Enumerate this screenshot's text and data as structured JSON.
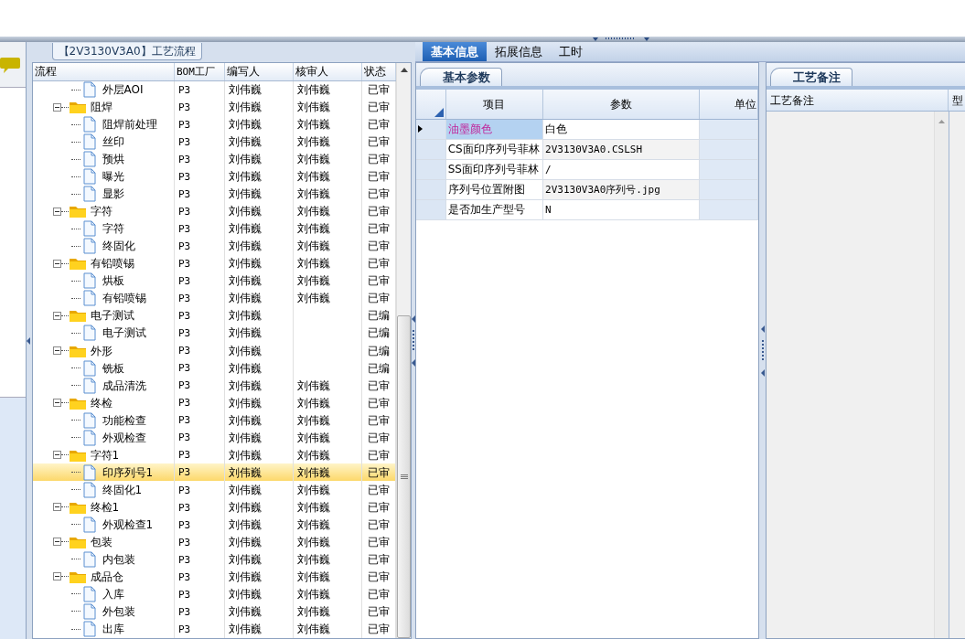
{
  "left_panel": {
    "title": "【2V3130V3A0】工艺流程",
    "columns": [
      "流程",
      "BOM工厂",
      "编写人",
      "核审人",
      "状态"
    ],
    "tree": [
      {
        "label": "外层AOI",
        "kind": "step",
        "selected": false,
        "bom": "P3",
        "author": "刘伟巍",
        "reviewer": "刘伟巍",
        "status": "已审"
      },
      {
        "label": "阻焊",
        "kind": "group",
        "expanded": true,
        "selected": false,
        "bom": "P3",
        "author": "刘伟巍",
        "reviewer": "刘伟巍",
        "status": "已审",
        "children": [
          {
            "label": "阻焊前处理",
            "kind": "step",
            "selected": false,
            "bom": "P3",
            "author": "刘伟巍",
            "reviewer": "刘伟巍",
            "status": "已审"
          },
          {
            "label": "丝印",
            "kind": "step",
            "selected": false,
            "bom": "P3",
            "author": "刘伟巍",
            "reviewer": "刘伟巍",
            "status": "已审"
          },
          {
            "label": "预烘",
            "kind": "step",
            "selected": false,
            "bom": "P3",
            "author": "刘伟巍",
            "reviewer": "刘伟巍",
            "status": "已审"
          },
          {
            "label": "曝光",
            "kind": "step",
            "selected": false,
            "bom": "P3",
            "author": "刘伟巍",
            "reviewer": "刘伟巍",
            "status": "已审"
          },
          {
            "label": "显影",
            "kind": "step",
            "selected": false,
            "bom": "P3",
            "author": "刘伟巍",
            "reviewer": "刘伟巍",
            "status": "已审"
          }
        ]
      },
      {
        "label": "字符",
        "kind": "group",
        "expanded": true,
        "selected": false,
        "bom": "P3",
        "author": "刘伟巍",
        "reviewer": "刘伟巍",
        "status": "已审",
        "children": [
          {
            "label": "字符",
            "kind": "step",
            "selected": false,
            "bom": "P3",
            "author": "刘伟巍",
            "reviewer": "刘伟巍",
            "status": "已审"
          },
          {
            "label": "终固化",
            "kind": "step",
            "selected": false,
            "bom": "P3",
            "author": "刘伟巍",
            "reviewer": "刘伟巍",
            "status": "已审"
          }
        ]
      },
      {
        "label": "有铅喷锡",
        "kind": "group",
        "expanded": true,
        "selected": false,
        "bom": "P3",
        "author": "刘伟巍",
        "reviewer": "刘伟巍",
        "status": "已审",
        "children": [
          {
            "label": "烘板",
            "kind": "step",
            "selected": false,
            "bom": "P3",
            "author": "刘伟巍",
            "reviewer": "刘伟巍",
            "status": "已审"
          },
          {
            "label": "有铅喷锡",
            "kind": "step",
            "selected": false,
            "bom": "P3",
            "author": "刘伟巍",
            "reviewer": "刘伟巍",
            "status": "已审"
          }
        ]
      },
      {
        "label": "电子测试",
        "kind": "group",
        "expanded": true,
        "selected": false,
        "bom": "P3",
        "author": "刘伟巍",
        "status": "已编",
        "children": [
          {
            "label": "电子测试",
            "kind": "step",
            "selected": false,
            "bom": "P3",
            "author": "刘伟巍",
            "status": "已编"
          }
        ]
      },
      {
        "label": "外形",
        "kind": "group",
        "expanded": true,
        "selected": false,
        "bom": "P3",
        "author": "刘伟巍",
        "status": "已编",
        "children": [
          {
            "label": "铣板",
            "kind": "step",
            "selected": false,
            "bom": "P3",
            "author": "刘伟巍",
            "status": "已编"
          },
          {
            "label": "成品清洗",
            "kind": "step",
            "selected": false,
            "bom": "P3",
            "author": "刘伟巍",
            "reviewer": "刘伟巍",
            "status": "已审"
          }
        ]
      },
      {
        "label": "终检",
        "kind": "group",
        "expanded": true,
        "selected": false,
        "bom": "P3",
        "author": "刘伟巍",
        "reviewer": "刘伟巍",
        "status": "已审",
        "children": [
          {
            "label": "功能检查",
            "kind": "step",
            "selected": false,
            "bom": "P3",
            "author": "刘伟巍",
            "reviewer": "刘伟巍",
            "status": "已审"
          },
          {
            "label": "外观检查",
            "kind": "step",
            "selected": false,
            "bom": "P3",
            "author": "刘伟巍",
            "reviewer": "刘伟巍",
            "status": "已审"
          }
        ]
      },
      {
        "label": "字符1",
        "kind": "group",
        "expanded": true,
        "selected": false,
        "bom": "P3",
        "author": "刘伟巍",
        "reviewer": "刘伟巍",
        "status": "已审",
        "children": [
          {
            "label": "印序列号1",
            "kind": "step",
            "selected": true,
            "bom": "P3",
            "author": "刘伟巍",
            "reviewer": "刘伟巍",
            "status": "已审"
          },
          {
            "label": "终固化1",
            "kind": "step",
            "selected": false,
            "bom": "P3",
            "author": "刘伟巍",
            "reviewer": "刘伟巍",
            "status": "已审"
          }
        ]
      },
      {
        "label": "终检1",
        "kind": "group",
        "expanded": true,
        "selected": false,
        "bom": "P3",
        "author": "刘伟巍",
        "reviewer": "刘伟巍",
        "status": "已审",
        "children": [
          {
            "label": "外观检查1",
            "kind": "step",
            "selected": false,
            "bom": "P3",
            "author": "刘伟巍",
            "reviewer": "刘伟巍",
            "status": "已审"
          }
        ]
      },
      {
        "label": "包装",
        "kind": "group",
        "expanded": true,
        "selected": false,
        "bom": "P3",
        "author": "刘伟巍",
        "reviewer": "刘伟巍",
        "status": "已审",
        "children": [
          {
            "label": "内包装",
            "kind": "step",
            "selected": false,
            "bom": "P3",
            "author": "刘伟巍",
            "reviewer": "刘伟巍",
            "status": "已审"
          }
        ]
      },
      {
        "label": "成品仓",
        "kind": "group",
        "expanded": true,
        "selected": false,
        "bom": "P3",
        "author": "刘伟巍",
        "reviewer": "刘伟巍",
        "status": "已审",
        "children": [
          {
            "label": "入库",
            "kind": "step",
            "selected": false,
            "bom": "P3",
            "author": "刘伟巍",
            "reviewer": "刘伟巍",
            "status": "已审"
          },
          {
            "label": "外包装",
            "kind": "step",
            "selected": false,
            "bom": "P3",
            "author": "刘伟巍",
            "reviewer": "刘伟巍",
            "status": "已审"
          },
          {
            "label": "出库",
            "kind": "step",
            "selected": false,
            "bom": "P3",
            "author": "刘伟巍",
            "reviewer": "刘伟巍",
            "status": "已审"
          }
        ]
      }
    ]
  },
  "tabs": [
    {
      "label": "基本信息",
      "selected": true
    },
    {
      "label": "拓展信息",
      "selected": false
    },
    {
      "label": "工时",
      "selected": false
    }
  ],
  "params_panel": {
    "tab": {
      "label": "基本参数",
      "selected": true
    },
    "columns": [
      "项目",
      "参数",
      "单位"
    ],
    "rows": [
      {
        "item": "油墨颜色",
        "value": "白色",
        "selected": true
      },
      {
        "item": "CS面印序列号菲林",
        "value": "2V3130V3A0.CSLSH",
        "selected": false
      },
      {
        "item": "SS面印序列号菲林",
        "value": "/",
        "selected": false
      },
      {
        "item": "序列号位置附图",
        "value": "2V3130V3A0序列号.jpg",
        "selected": false
      },
      {
        "item": "是否加生产型号",
        "value": "N",
        "selected": false
      }
    ]
  },
  "notes_panel": {
    "tab": {
      "label": "工艺备注",
      "selected": true
    },
    "columns": [
      "工艺备注",
      "型"
    ]
  }
}
